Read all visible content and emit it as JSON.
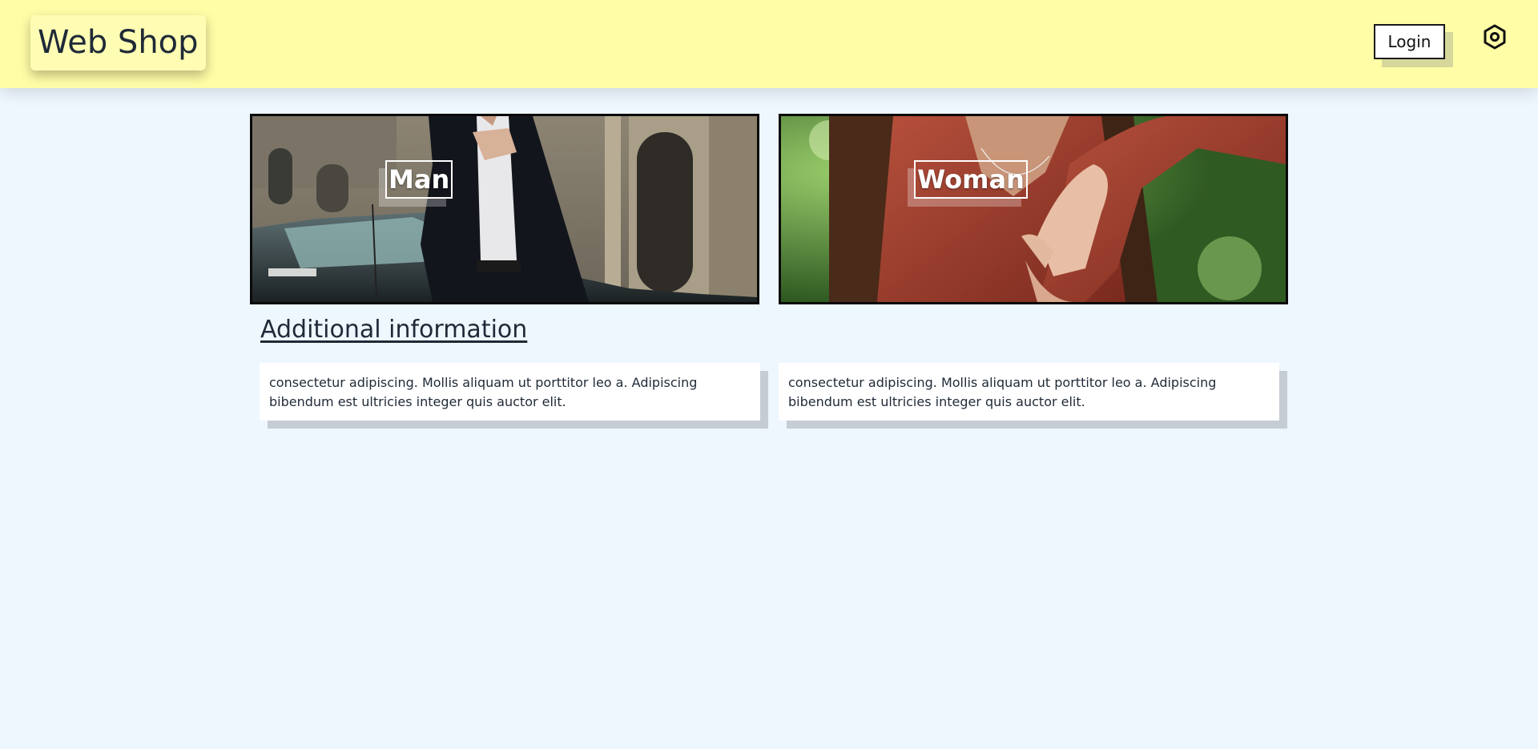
{
  "header": {
    "logo": "Web Shop",
    "login_label": "Login",
    "settings_icon": "settings-hexagon-icon"
  },
  "categories": [
    {
      "label": "Man"
    },
    {
      "label": "Woman"
    }
  ],
  "info": {
    "title": "Additional information",
    "boxes": [
      {
        "text": "consectetur adipiscing. Mollis aliquam ut porttitor leo a. Adipiscing bibendum est ultricies integer quis auctor elit."
      },
      {
        "text": "consectetur adipiscing. Mollis aliquam ut porttitor leo a. Adipiscing bibendum est ultricies integer quis auctor elit."
      }
    ]
  },
  "colors": {
    "header_bg": "#fffda6",
    "page_bg": "#eef6fe",
    "text": "#1f2a37"
  }
}
